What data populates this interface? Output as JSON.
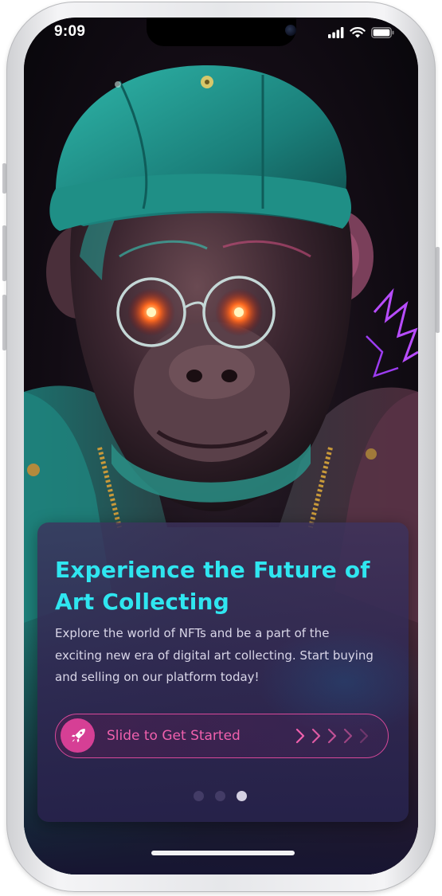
{
  "status_bar": {
    "time": "9:09",
    "icons": [
      "cellular-signal-icon",
      "wifi-icon",
      "battery-icon"
    ]
  },
  "onboarding": {
    "title": "Experience the Future of Art Collecting",
    "description": "Explore the world of NFTs and be a part of the exciting new era of digital art collecting. Start buying and selling on our platform today!",
    "slider": {
      "label": "Slide to Get Started",
      "knob_icon": "rocket-icon",
      "chevron_icon": "chevron-right-icon"
    },
    "pagination": {
      "total": 3,
      "active_index": 2
    }
  },
  "colors": {
    "title_cyan": "#2fe6f0",
    "accent_pink": "#d63f95",
    "card_bg": "#2f2852",
    "dot_inactive": "#433c66",
    "dot_active": "#d4d0e2"
  }
}
